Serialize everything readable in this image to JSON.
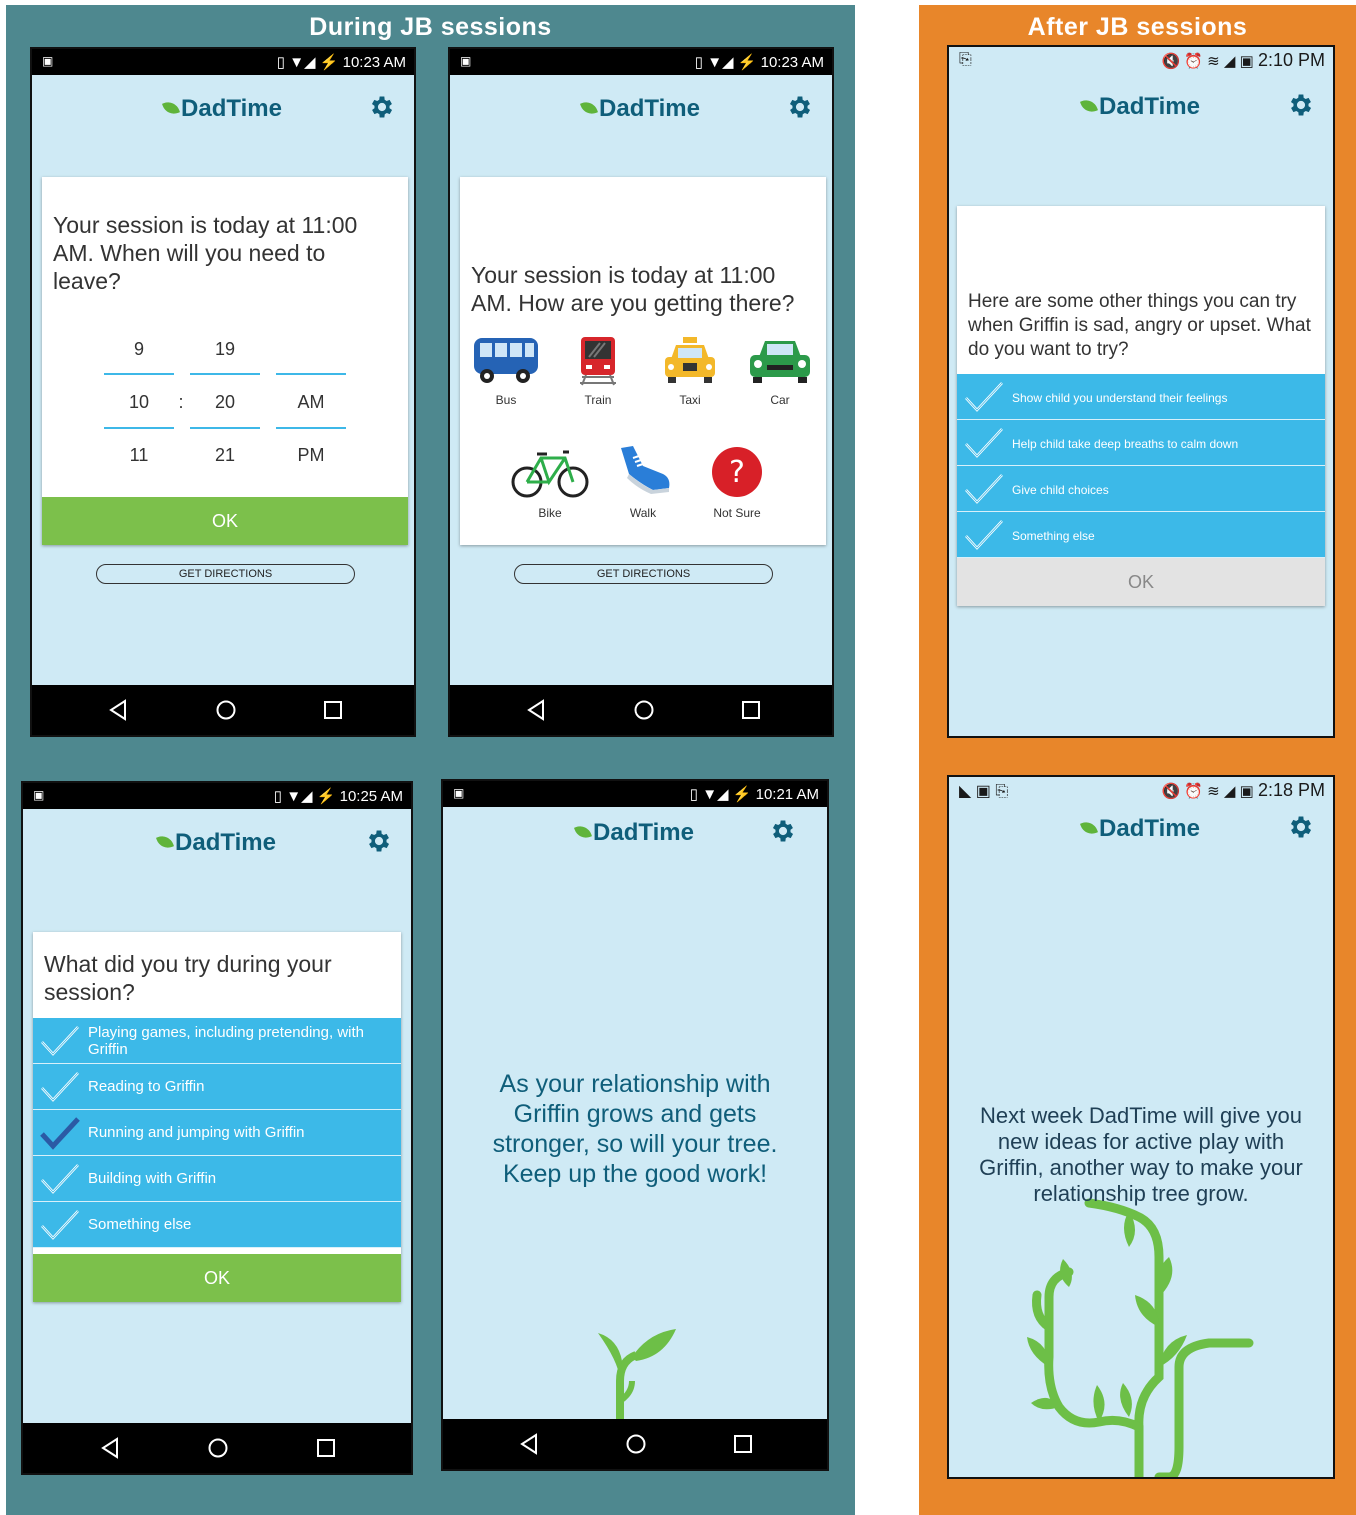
{
  "panels": {
    "left_title": "During JB sessions",
    "right_title": "After JB sessions"
  },
  "app": {
    "name": "DadTime"
  },
  "screens": {
    "leave_time": {
      "status_time": "10:23 AM",
      "question": "Your session is today at 11:00 AM. When will you need to leave?",
      "picker": {
        "hours": [
          "9",
          "10",
          "11"
        ],
        "minutes": [
          "19",
          "20",
          "21"
        ],
        "ampm": [
          "",
          "AM",
          "PM"
        ],
        "separator": ":"
      },
      "ok_label": "OK",
      "directions_label": "GET DIRECTIONS"
    },
    "transport": {
      "status_time": "10:23 AM",
      "question": "Your session is today at 11:00 AM. How are you getting there?",
      "options": [
        "Bus",
        "Train",
        "Taxi",
        "Car",
        "Bike",
        "Walk",
        "Not Sure"
      ],
      "directions_label": "GET DIRECTIONS"
    },
    "tried": {
      "status_time": "10:25 AM",
      "question": "What did you try during your session?",
      "options": [
        "Playing games, including pretending, with Griffin",
        "Reading to Griffin",
        "Running and jumping with Griffin",
        "Building with Griffin",
        "Something else"
      ],
      "selected_index": 2,
      "ok_label": "OK"
    },
    "tree_message": {
      "status_time": "10:21 AM",
      "message": "As your relationship with Griffin grows and gets stronger, so will your tree. Keep up the good work!"
    },
    "other_things": {
      "status_time": "2:10 PM",
      "question": "Here are some other things you can try when Griffin is sad, angry or upset. What do you want to try?",
      "options": [
        "Show child you understand their feelings",
        "Help child take deep breaths to calm down",
        "Give child choices",
        "Something else"
      ],
      "ok_label": "OK"
    },
    "next_week": {
      "status_time": "2:18 PM",
      "message": "Next week DadTime will give you new ideas for active play with Griffin, another way to make your relationship tree grow."
    }
  },
  "colors": {
    "panel_during": "#4e888f",
    "panel_after": "#e8862a",
    "screen_bg": "#cfeaf5",
    "accent_blue": "#3cb9e8",
    "ok_green": "#7cc04b",
    "brand_text": "#0f5e7a",
    "leaf_green": "#6dbf47"
  }
}
